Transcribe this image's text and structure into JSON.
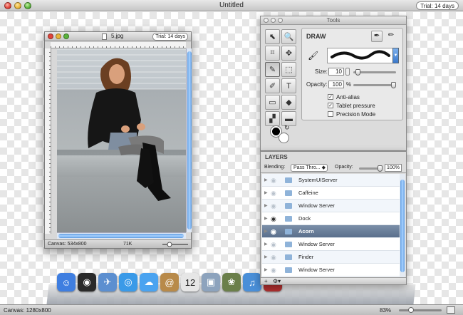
{
  "window": {
    "title": "Untitled",
    "trial_badge": "Trial: 14 days"
  },
  "document": {
    "filename": "5.jpg",
    "trial_badge": "Trial: 14 days",
    "canvas_size": "Canvas: 534x800",
    "file_size": "71K",
    "zoom_icon": "zoom-slider-icon"
  },
  "status": {
    "canvas": "Canvas: 1280x800",
    "zoom": "83%"
  },
  "tools_panel": {
    "title": "Tools",
    "tools": [
      {
        "name": "arrow-tool",
        "icon": "⬉",
        "active": false
      },
      {
        "name": "magnifier-tool",
        "icon": "🔍",
        "active": false
      },
      {
        "name": "crop-tool",
        "icon": "⌗",
        "active": false
      },
      {
        "name": "move-tool",
        "icon": "✥",
        "active": false
      },
      {
        "name": "brush-tool",
        "icon": "✎",
        "active": true
      },
      {
        "name": "marquee-tool",
        "icon": "⬚",
        "active": false
      },
      {
        "name": "eraser-tool",
        "icon": "✐",
        "active": false
      },
      {
        "name": "text-tool",
        "icon": "T",
        "active": false
      },
      {
        "name": "gradient-tool",
        "icon": "▭",
        "active": false
      },
      {
        "name": "bucket-tool",
        "icon": "◆",
        "active": false
      },
      {
        "name": "clone-tool",
        "icon": "▞",
        "active": false
      },
      {
        "name": "shape-tool",
        "icon": "▬",
        "active": false
      }
    ],
    "draw": {
      "title": "DRAW",
      "size_label": "Size:",
      "size_value": "10",
      "opacity_label": "Opacity:",
      "opacity_value": "100",
      "opacity_unit": "%",
      "size_level": 0.05,
      "opacity_level": 1.0,
      "anti_alias_label": "Anti-alias",
      "anti_alias": true,
      "tablet_pressure_label": "Tablet pressure",
      "tablet_pressure": true,
      "precision_mode_label": "Precision Mode",
      "precision_mode": false
    }
  },
  "layers_panel": {
    "title": "LAYERS",
    "blending_label": "Blending:",
    "blending_value": "Pass Thro...",
    "opacity_label": "Opacity:",
    "opacity_value": "100%",
    "layers": [
      {
        "name": "SystemUIServer",
        "visible": false,
        "selected": false
      },
      {
        "name": "Caffeine",
        "visible": false,
        "selected": false
      },
      {
        "name": "Window Server",
        "visible": false,
        "selected": false
      },
      {
        "name": "Dock",
        "visible": true,
        "selected": false
      },
      {
        "name": "Acorn",
        "visible": true,
        "selected": true
      },
      {
        "name": "Window Server",
        "visible": false,
        "selected": false
      },
      {
        "name": "Finder",
        "visible": false,
        "selected": false
      },
      {
        "name": "Window Server",
        "visible": false,
        "selected": false
      }
    ]
  },
  "dock": {
    "apps": [
      {
        "name": "finder-icon",
        "color": "#3f7ee0",
        "glyph": "☺"
      },
      {
        "name": "dashboard-icon",
        "color": "#2a2a2a",
        "glyph": "◉"
      },
      {
        "name": "mail-icon",
        "color": "#5c8fd0",
        "glyph": "✈"
      },
      {
        "name": "safari-icon",
        "color": "#3a9ae8",
        "glyph": "◎"
      },
      {
        "name": "ichat-icon",
        "color": "#4aa3f0",
        "glyph": "☁"
      },
      {
        "name": "address-book-icon",
        "color": "#b88a4a",
        "glyph": "@"
      },
      {
        "name": "ical-icon",
        "color": "#e6e6e6",
        "glyph": "12"
      },
      {
        "name": "preview-icon",
        "color": "#8da3bd",
        "glyph": "▣"
      },
      {
        "name": "iphoto-icon",
        "color": "#6b7f4a",
        "glyph": "❀"
      },
      {
        "name": "itunes-icon",
        "color": "#4a8fd8",
        "glyph": "♫"
      },
      {
        "name": "photo-booth-icon",
        "color": "#b03030",
        "glyph": "◐"
      }
    ]
  }
}
